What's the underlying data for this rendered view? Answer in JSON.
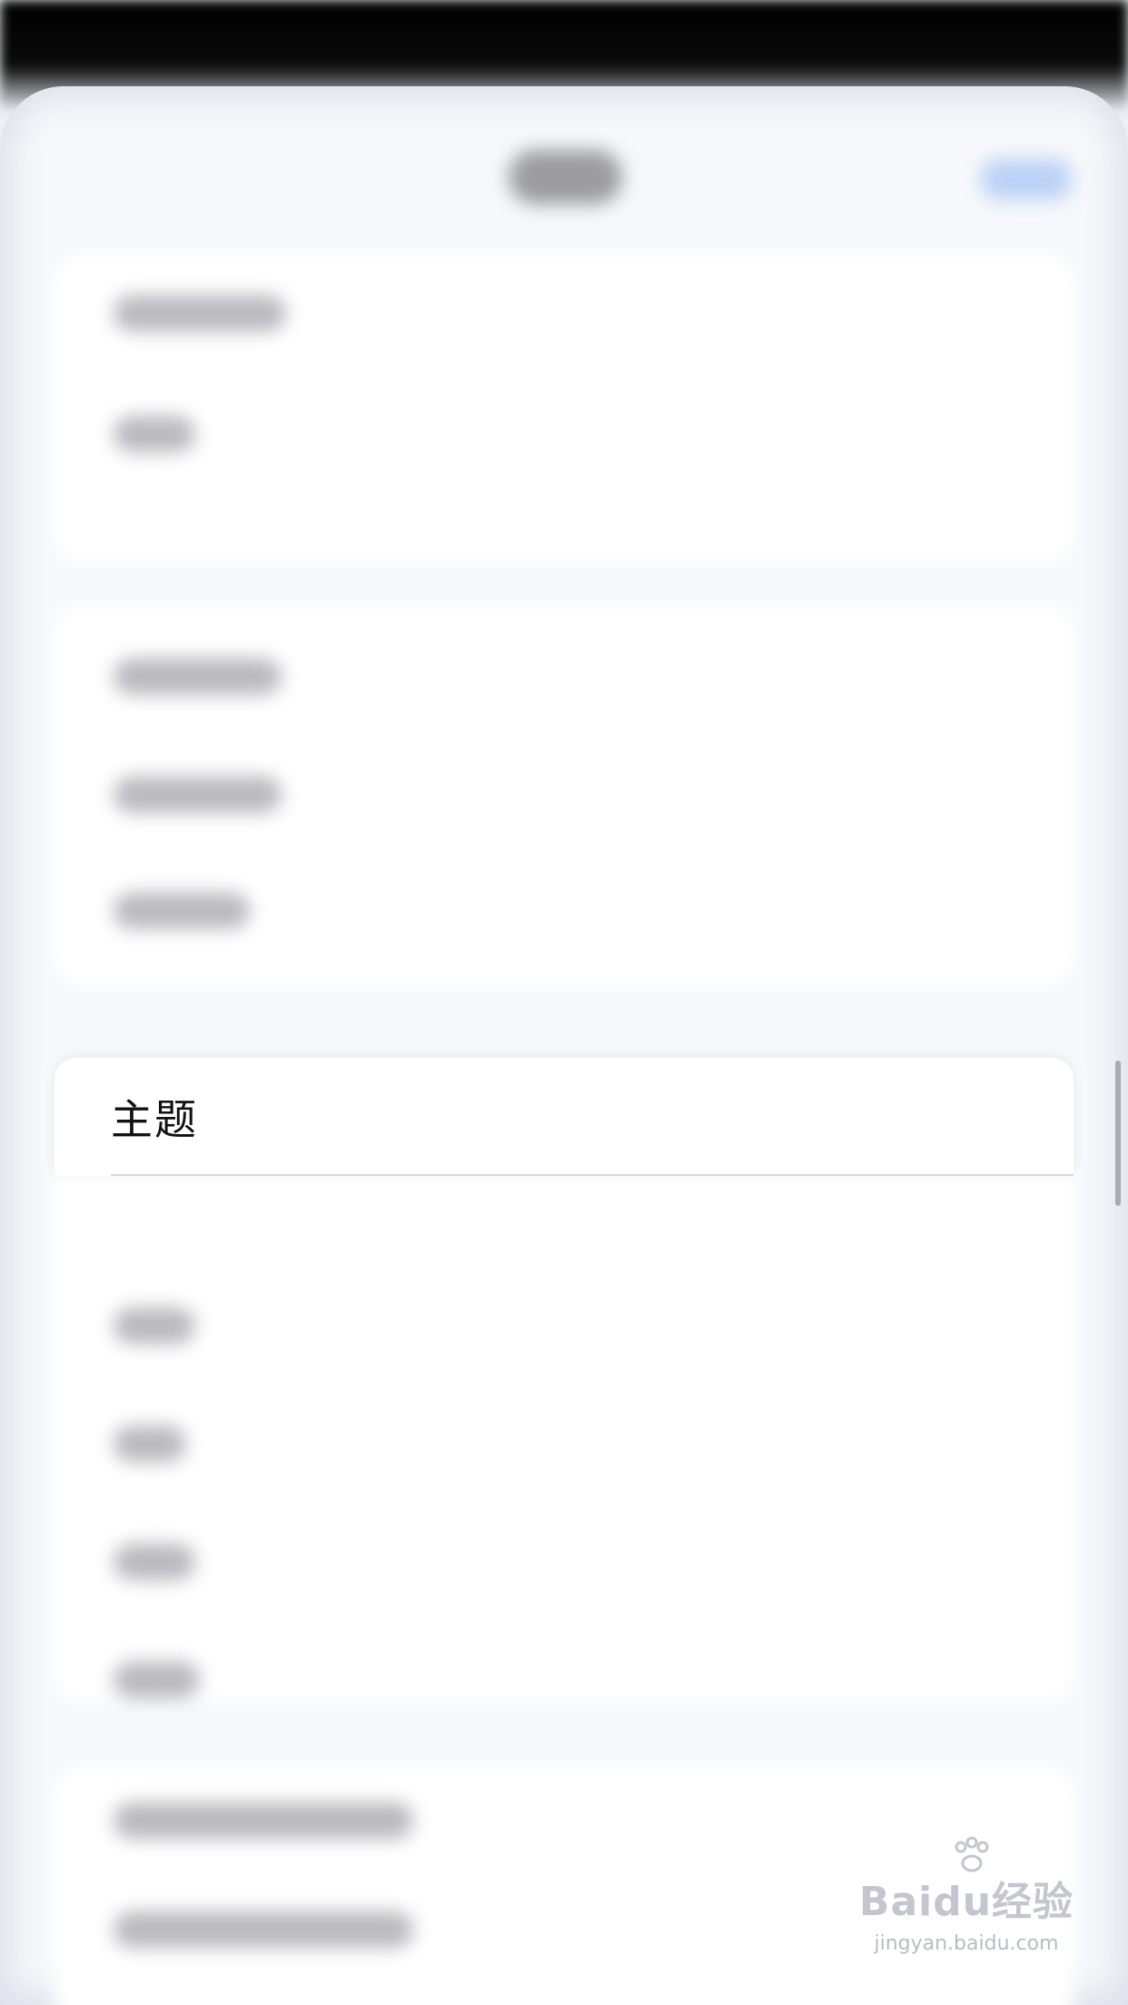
{
  "focused_row": {
    "label": "主题"
  },
  "watermark": {
    "logo": "Baidu经验",
    "url": "jingyan.baidu.com"
  },
  "colors": {
    "accent_blur": "#9dbdf2",
    "sheet_background": "#f7f8fb",
    "row_background": "#ffffff"
  }
}
